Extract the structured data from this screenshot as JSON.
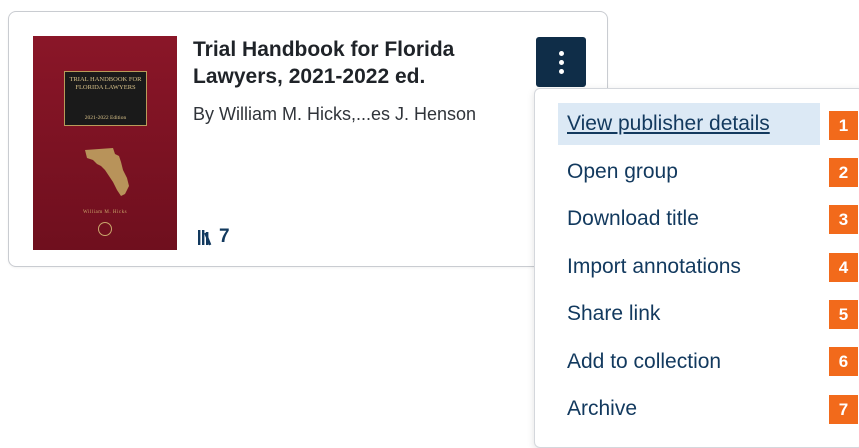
{
  "book": {
    "title": "Trial Handbook for Florida Lawyers, 2021-2022 ed.",
    "author": "By William M. Hicks,...es J. Henson",
    "copies": "7",
    "cover": {
      "panel_text": "Trial Handbook for Florida Lawyers",
      "edition": "2021-2022 Edition",
      "author_text": "William M. Hicks",
      "background_color": "#7d1322",
      "accent_color": "#c9a66b"
    }
  },
  "menu": {
    "items": [
      {
        "label": "View publisher details",
        "badge": "1",
        "active": true
      },
      {
        "label": "Open group",
        "badge": "2"
      },
      {
        "label": "Download title",
        "badge": "3"
      },
      {
        "label": "Import annotations",
        "badge": "4"
      },
      {
        "label": "Share link",
        "badge": "5"
      },
      {
        "label": "Add to collection",
        "badge": "6"
      },
      {
        "label": "Archive",
        "badge": "7"
      }
    ]
  },
  "colors": {
    "kebab_bg": "#0f2d48",
    "link": "#12395e",
    "highlight": "#dce9f5",
    "badge": "#f26a1b"
  },
  "icons": {
    "more": "vertical-ellipsis-icon",
    "copies": "books-icon",
    "state_map": "florida-map-icon"
  }
}
